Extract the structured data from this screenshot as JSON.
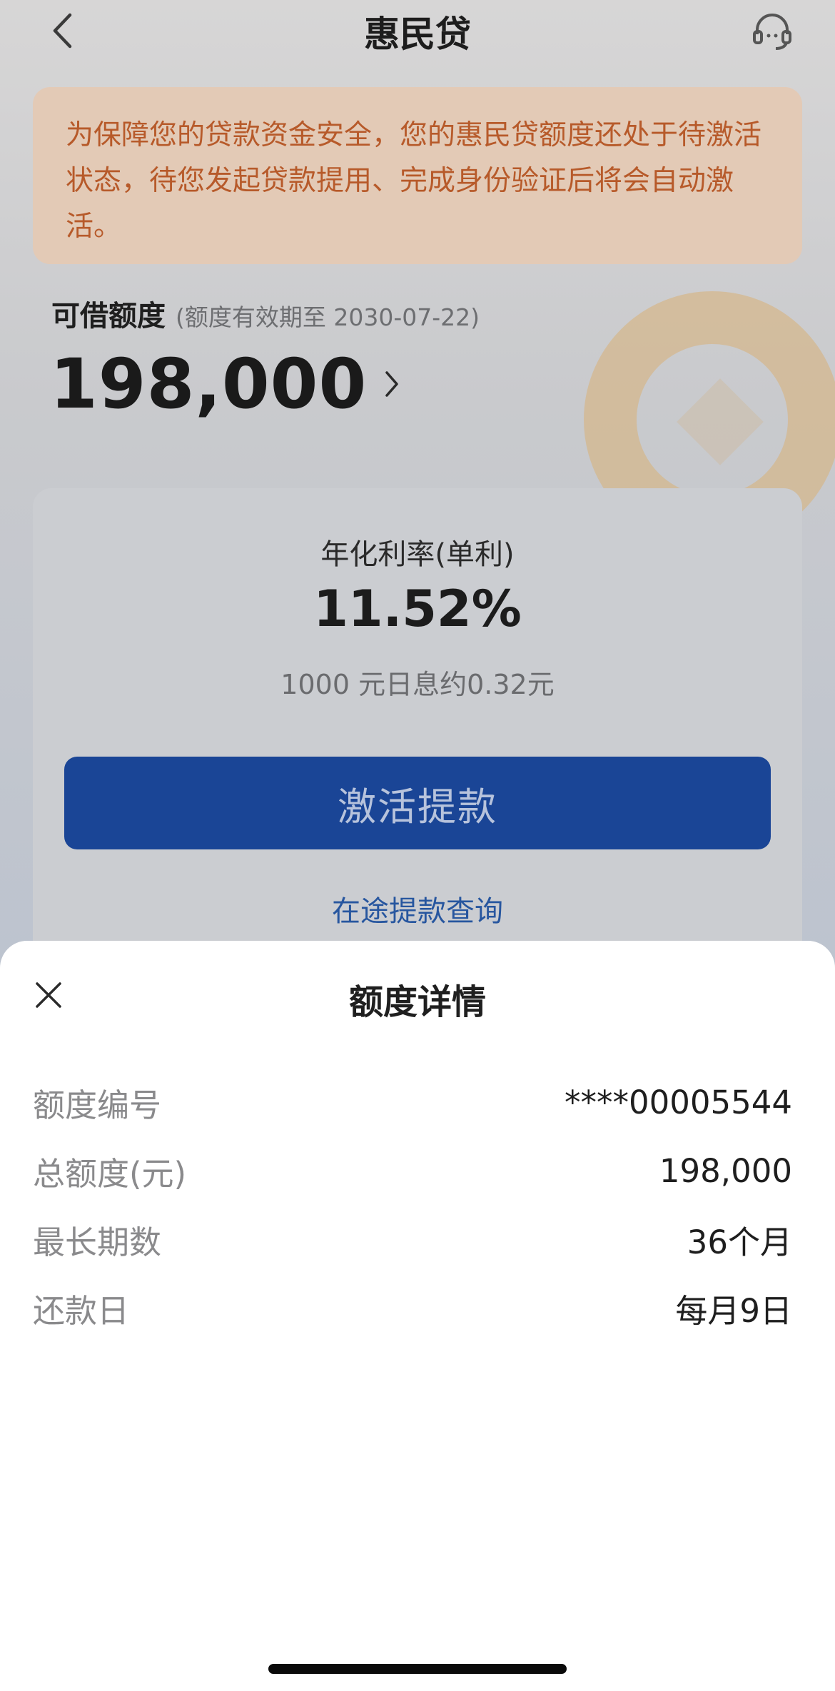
{
  "nav": {
    "title": "惠民贷",
    "back_icon": "chevron-left-icon",
    "service_icon": "headset-icon"
  },
  "notice": {
    "text": "为保障您的贷款资金安全，您的惠民贷额度还处于待激活状态，待您发起贷款提用、完成身份验证后将会自动激活。"
  },
  "limit": {
    "label": "可借额度",
    "validity": "(额度有效期至 2030-07-22)",
    "amount": "198,000"
  },
  "rate_card": {
    "title": "年化利率(单利)",
    "rate": "11.52%",
    "interest_note": "1000 元日息约0.32元",
    "activate_label": "激活提款",
    "transit_link": "在途提款查询"
  },
  "sheet": {
    "title": "额度详情",
    "rows": [
      {
        "label": "额度编号",
        "value": "****00005544"
      },
      {
        "label": "总额度(元)",
        "value": "198,000"
      },
      {
        "label": "最长期数",
        "value": "36个月"
      },
      {
        "label": "还款日",
        "value": "每月9日"
      }
    ]
  },
  "colors": {
    "accent_blue": "#1a4596",
    "notice_text": "#b75a2a",
    "link_blue": "#27569f"
  }
}
